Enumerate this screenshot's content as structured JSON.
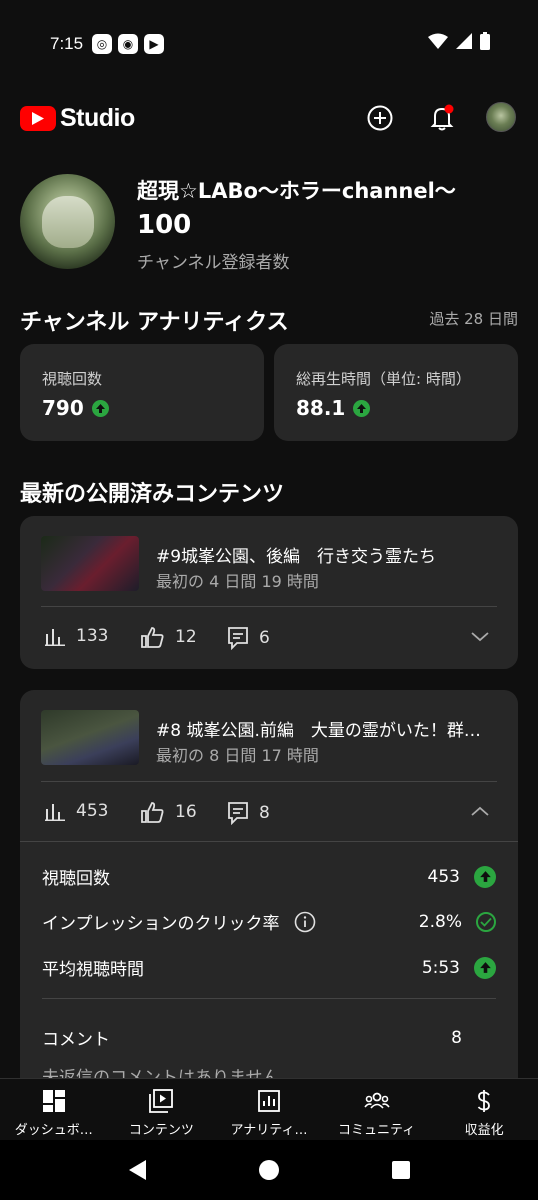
{
  "status_bar": {
    "time": "7:15"
  },
  "header": {
    "app_title": "Studio"
  },
  "channel": {
    "name": "超現☆LABo〜ホラーchannel〜",
    "subscribers": "100",
    "subscribers_label": "チャンネル登録者数"
  },
  "analytics": {
    "title": "チャンネル アナリティクス",
    "period": "過去 28 日間",
    "cards": [
      {
        "label": "視聴回数",
        "value": "790"
      },
      {
        "label": "総再生時間（単位: 時間）",
        "value": "88.1"
      }
    ]
  },
  "latest": {
    "title": "最新の公開済みコンテンツ",
    "videos": [
      {
        "title": "#9城峯公園、後編　行き交う霊たち",
        "subtitle": "最初の 4 日間 19 時間",
        "views": "133",
        "likes": "12",
        "comments": "6"
      },
      {
        "title": "#8 城峯公園.前編　大量の霊がいた！群…",
        "subtitle": "最初の 8 日間 17 時間",
        "views": "453",
        "likes": "16",
        "comments": "8",
        "details": [
          {
            "label": "視聴回数",
            "value": "453"
          },
          {
            "label": "インプレッションのクリック率",
            "value": "2.8%"
          },
          {
            "label": "平均視聴時間",
            "value": "5:53"
          }
        ],
        "comments_label": "コメント",
        "comments_count": "8",
        "no_reply_text": "未返信のコメントはありません"
      }
    ]
  },
  "bottom_nav": [
    {
      "label": "ダッシュボ…",
      "icon": "dashboard-icon"
    },
    {
      "label": "コンテンツ",
      "icon": "content-icon"
    },
    {
      "label": "アナリティ…",
      "icon": "analytics-icon"
    },
    {
      "label": "コミュニティ",
      "icon": "community-icon"
    },
    {
      "label": "収益化",
      "icon": "monetization-icon"
    }
  ],
  "colors": {
    "background": "#0f0f0f",
    "card": "#272727",
    "accent_red": "#ff0000",
    "positive_green": "#2ba640",
    "secondary_text": "#aaaaaa"
  }
}
